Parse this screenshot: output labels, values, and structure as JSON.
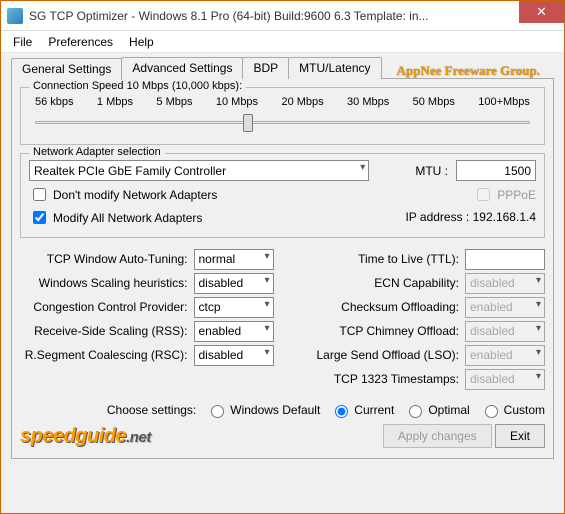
{
  "window": {
    "title": "SG TCP Optimizer - Windows 8.1 Pro (64-bit) Build:9600 6.3  Template: in..."
  },
  "menu": {
    "file": "File",
    "preferences": "Preferences",
    "help": "Help"
  },
  "watermark": "AppNee Freeware Group.",
  "tabs": {
    "general": "General Settings",
    "advanced": "Advanced Settings",
    "bdp": "BDP",
    "mtu": "MTU/Latency"
  },
  "connection": {
    "legend": "Connection Speed  10 Mbps (10,000 kbps):",
    "labels": [
      "56 kbps",
      "1 Mbps",
      "5 Mbps",
      "10 Mbps",
      "20 Mbps",
      "30 Mbps",
      "50 Mbps",
      "100+Mbps"
    ]
  },
  "adapter": {
    "legend": "Network Adapter selection",
    "selected": "Realtek PCIe GbE Family Controller",
    "mtu_label": "MTU :",
    "mtu_value": "1500",
    "chk1": "Don't modify Network Adapters",
    "chk2": "Modify All Network Adapters",
    "pppoe": "PPPoE",
    "ip_label": "IP address : 192.168.1.4"
  },
  "left": {
    "r1": {
      "label": "TCP Window Auto-Tuning:",
      "value": "normal"
    },
    "r2": {
      "label": "Windows Scaling heuristics:",
      "value": "disabled"
    },
    "r3": {
      "label": "Congestion Control Provider:",
      "value": "ctcp"
    },
    "r4": {
      "label": "Receive-Side Scaling (RSS):",
      "value": "enabled"
    },
    "r5": {
      "label": "R.Segment Coalescing (RSC):",
      "value": "disabled"
    }
  },
  "right": {
    "r1": {
      "label": "Time to Live (TTL):",
      "value": ""
    },
    "r2": {
      "label": "ECN Capability:",
      "value": "disabled"
    },
    "r3": {
      "label": "Checksum Offloading:",
      "value": "enabled"
    },
    "r4": {
      "label": "TCP Chimney Offload:",
      "value": "disabled"
    },
    "r5": {
      "label": "Large Send Offload (LSO):",
      "value": "enabled"
    },
    "r6": {
      "label": "TCP 1323 Timestamps:",
      "value": "disabled"
    }
  },
  "choose": {
    "label": "Choose settings:",
    "o1": "Windows Default",
    "o2": "Current",
    "o3": "Optimal",
    "o4": "Custom"
  },
  "buttons": {
    "apply": "Apply changes",
    "exit": "Exit"
  },
  "logo": {
    "p1": "speedguide",
    "p2": ".net"
  }
}
